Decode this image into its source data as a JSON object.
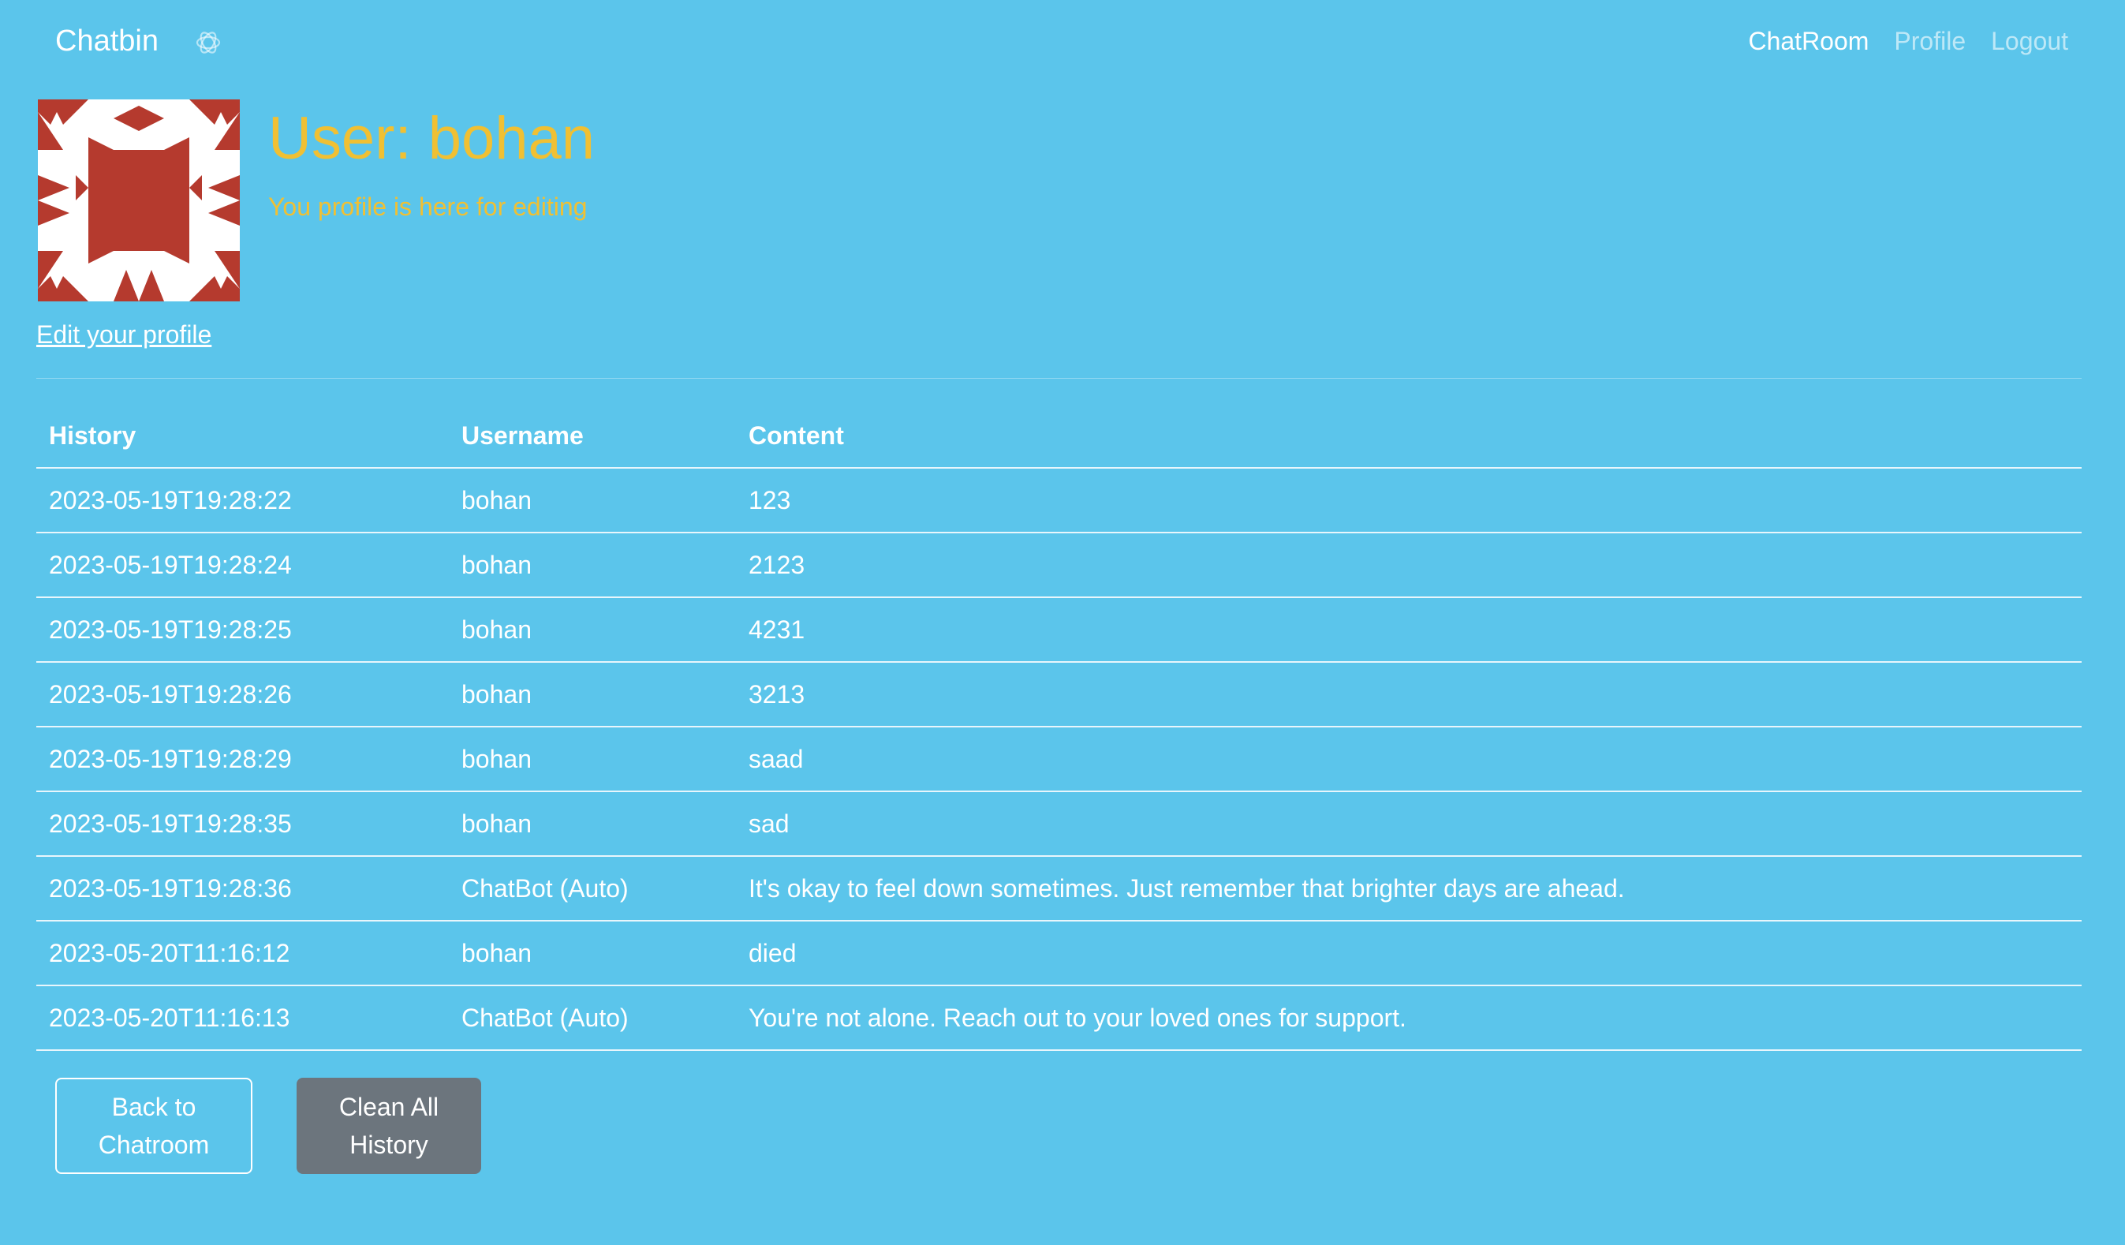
{
  "navbar": {
    "brand": "Chatbin",
    "brand_icon": "openai-logo-icon",
    "links": {
      "chatroom": "ChatRoom",
      "profile": "Profile",
      "logout": "Logout"
    }
  },
  "profile": {
    "avatar_icon": "identicon-avatar",
    "avatar_color": "#b53a2e",
    "title": "User: bohan",
    "subtitle": "You profile is here for editing",
    "edit_link": "Edit your profile"
  },
  "history_table": {
    "headers": [
      "History",
      "Username",
      "Content"
    ],
    "rows": [
      [
        "2023-05-19T19:28:22",
        "bohan",
        "123"
      ],
      [
        "2023-05-19T19:28:24",
        "bohan",
        "2123"
      ],
      [
        "2023-05-19T19:28:25",
        "bohan",
        "4231"
      ],
      [
        "2023-05-19T19:28:26",
        "bohan",
        "3213"
      ],
      [
        "2023-05-19T19:28:29",
        "bohan",
        "saad"
      ],
      [
        "2023-05-19T19:28:35",
        "bohan",
        "sad"
      ],
      [
        "2023-05-19T19:28:36",
        "ChatBot (Auto)",
        "It's okay to feel down sometimes. Just remember that brighter days are ahead."
      ],
      [
        "2023-05-20T11:16:12",
        "bohan",
        "died"
      ],
      [
        "2023-05-20T11:16:13",
        "ChatBot (Auto)",
        "You're not alone. Reach out to your loved ones for support."
      ]
    ]
  },
  "buttons": {
    "back_line1": "Back to",
    "back_line2": "Chatroom",
    "clean_line1": "Clean All",
    "clean_line2": "History"
  },
  "colors": {
    "background": "#5bc5eb",
    "title_accent": "#f0c033",
    "secondary_button": "#6c757d"
  }
}
